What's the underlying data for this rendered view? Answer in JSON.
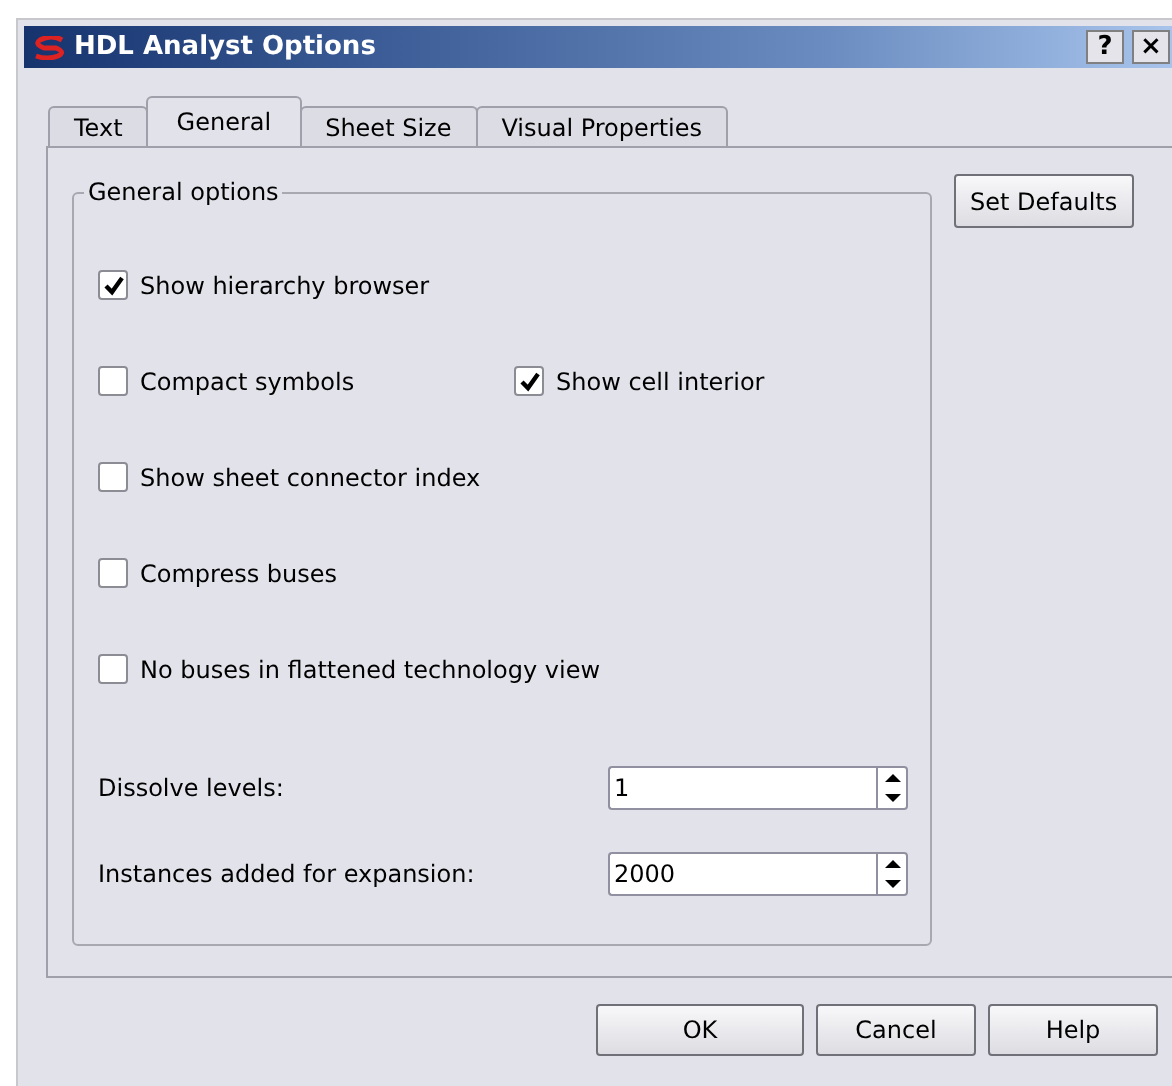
{
  "window": {
    "title": "HDL Analyst Options",
    "title_buttons": [
      "?",
      "×"
    ]
  },
  "tabs": [
    {
      "label": "Text",
      "selected": false
    },
    {
      "label": "General",
      "selected": true
    },
    {
      "label": "Sheet Size",
      "selected": false
    },
    {
      "label": "Visual Properties",
      "selected": false
    }
  ],
  "group": {
    "title": "General options",
    "rows": [
      [
        {
          "label": "Show hierarchy browser",
          "checked": true
        }
      ],
      [
        {
          "label": "Compact symbols",
          "checked": false
        },
        {
          "label": "Show cell interior",
          "checked": true
        }
      ],
      [
        {
          "label": "Show sheet connector index",
          "checked": false
        }
      ],
      [
        {
          "label": "Compress buses",
          "checked": false
        }
      ],
      [
        {
          "label": "No buses in flattened technology view",
          "checked": false
        }
      ]
    ],
    "spinners": [
      {
        "label": "Dissolve levels:",
        "value": "1"
      },
      {
        "label": "Instances added for expansion:",
        "value": "2000"
      }
    ]
  },
  "side_button": "Set Defaults",
  "buttons": [
    "OK",
    "Cancel",
    "Help"
  ]
}
